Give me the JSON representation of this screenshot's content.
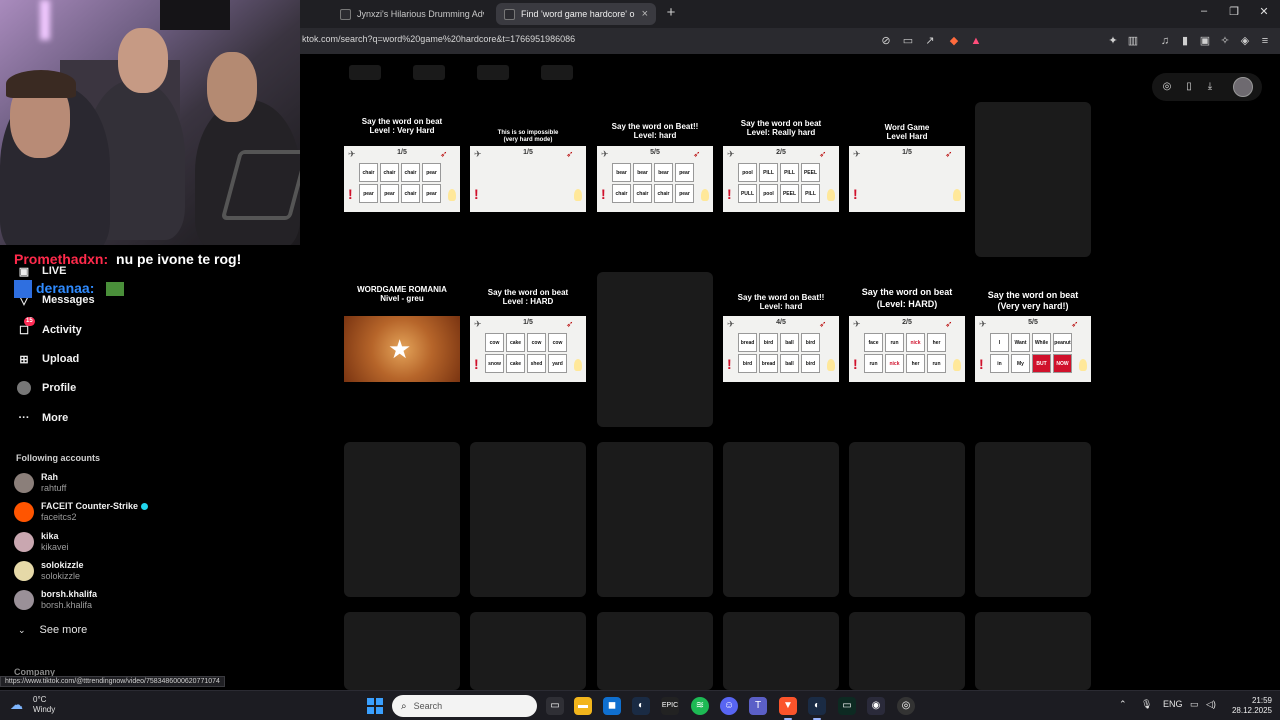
{
  "browser": {
    "tabs": [
      {
        "title": "Jynxzi's Hilarious Drumming Adventu",
        "active": false
      },
      {
        "title": "Find 'word game hardcore' o",
        "active": true
      }
    ],
    "url": "ktok.com/search?q=word%20game%20hardcore&t=1766951986086",
    "status_url": "https://www.tiktok.com/@tttrendingnow/video/7583486000620771074"
  },
  "stream_chat": [
    {
      "user": "Promethadxn:",
      "message": "nu pe ivone te rog!"
    },
    {
      "user": "deranaa:",
      "message": ""
    }
  ],
  "sidebar": {
    "nav": [
      {
        "label": "LIVE",
        "icon": "live-icon"
      },
      {
        "label": "Messages",
        "icon": "messages-icon"
      },
      {
        "label": "Activity",
        "icon": "activity-icon",
        "badge": "15"
      },
      {
        "label": "Upload",
        "icon": "upload-icon"
      },
      {
        "label": "Profile",
        "icon": "profile-icon"
      },
      {
        "label": "More",
        "icon": "more-icon"
      }
    ],
    "following_title": "Following accounts",
    "accounts": [
      {
        "name": "Rah",
        "handle": "rahtuff"
      },
      {
        "name": "FACEIT Counter-Strike",
        "handle": "faceitcs2",
        "verified": true
      },
      {
        "name": "kika",
        "handle": "kikavei"
      },
      {
        "name": "solokizzle",
        "handle": "solokizzle"
      },
      {
        "name": "borsh.khalifa",
        "handle": "borsh.khalifa"
      }
    ],
    "see_more": "See more",
    "company": "Company"
  },
  "results": [
    {
      "title": "Say the word on beat\nLevel : Very Hard",
      "count": "1/5",
      "cells": [
        "chair",
        "chair",
        "chair",
        "pear",
        "pear",
        "pear",
        "chair",
        "pear"
      ]
    },
    {
      "title": "This is so impossible\n(very hard mode)",
      "count": "1/5",
      "cells": []
    },
    {
      "title": "Say the word on Beat!!\nLevel: hard",
      "count": "5/5",
      "cells": [
        "bear",
        "bear",
        "bear",
        "pear",
        "chair",
        "chair",
        "chair",
        "pear"
      ]
    },
    {
      "title": "Say the word on beat\nLevel: Really hard",
      "count": "2/5",
      "cells": [
        "pool",
        "PILL",
        "PILL",
        "PEEL",
        "PULL",
        "pool",
        "PEEL",
        "PILL"
      ]
    },
    {
      "title": "Word Game\nLevel Hard",
      "count": "1/5",
      "cells": []
    },
    {
      "title": "WORDGAME ROMANIA\nNivel - greu",
      "count": "",
      "cells": []
    },
    {
      "title": "Say the word on beat\nLevel : HARD",
      "count": "1/5",
      "cells": [
        "cow",
        "cake",
        "cow",
        "cow",
        "snow",
        "cake",
        "shed",
        "yard"
      ]
    },
    {
      "title": "Say the word on Beat!!\nLevel: hard",
      "count": "4/5",
      "cells": [
        "bread",
        "bird",
        "ball",
        "bird",
        "bird",
        "bread",
        "ball",
        "bird"
      ]
    },
    {
      "title": "Say the word on beat\n(Level: HARD)",
      "count": "2/5",
      "cells": [
        "face",
        "run",
        "nick",
        "her",
        "run",
        "nick",
        "her",
        "run"
      ]
    },
    {
      "title": "Say the word on beat\n(Very very hard!)",
      "count": "5/5",
      "cells": [
        "I",
        "Want",
        "While",
        "peanut",
        "in",
        "My",
        "BUT",
        "NOW"
      ]
    }
  ],
  "taskbar": {
    "weather_temp": "0°C",
    "weather_desc": "Windy",
    "search_placeholder": "Search",
    "lang": "ENG",
    "time": "21:59",
    "date": "28.12.2025"
  }
}
